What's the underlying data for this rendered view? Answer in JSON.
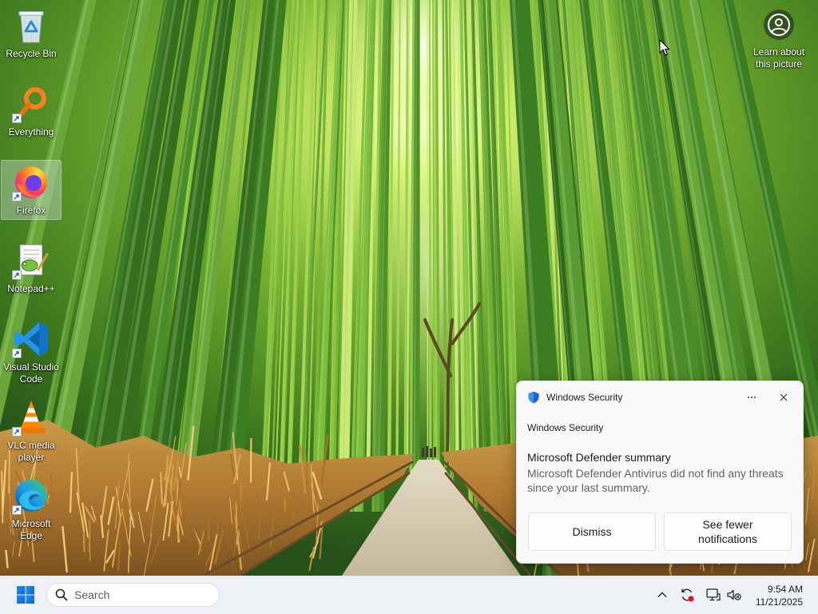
{
  "desktop": {
    "icons": [
      {
        "label": "Recycle Bin",
        "icon": "recycle-bin-icon"
      },
      {
        "label": "Everything",
        "icon": "everything-search-icon"
      },
      {
        "label": "Firefox",
        "icon": "firefox-icon",
        "selected": true
      },
      {
        "label": "Notepad++",
        "icon": "notepad-plus-plus-icon"
      },
      {
        "label": "Visual Studio Code",
        "icon": "vscode-icon"
      },
      {
        "label": "VLC media player",
        "icon": "vlc-icon"
      },
      {
        "label": "Microsoft Edge",
        "icon": "edge-icon"
      }
    ],
    "spotlight": {
      "label": "Learn about this picture",
      "icon": "spotlight-icon"
    }
  },
  "notification": {
    "app_name": "Windows Security",
    "app_icon": "shield-icon",
    "attribution": "Windows Security",
    "title": "Microsoft Defender summary",
    "body": "Microsoft Defender Antivirus did not find any threats since your last summary.",
    "buttons": {
      "dismiss": "Dismiss",
      "see_fewer": "See fewer notifications"
    }
  },
  "taskbar": {
    "start_icon": "windows-logo-icon",
    "search_placeholder": "Search",
    "tray_icons": [
      "chevron-up-icon",
      "update-sync-icon",
      "network-icon",
      "volume-icon"
    ],
    "clock": {
      "time": "9:54 AM",
      "date": "11/21/2025"
    }
  },
  "colors": {
    "accent": "#0067c0",
    "taskbar_bg": "#eef1f6",
    "toast_bg": "#f9f9f9",
    "alert_dot": "#e81123"
  }
}
